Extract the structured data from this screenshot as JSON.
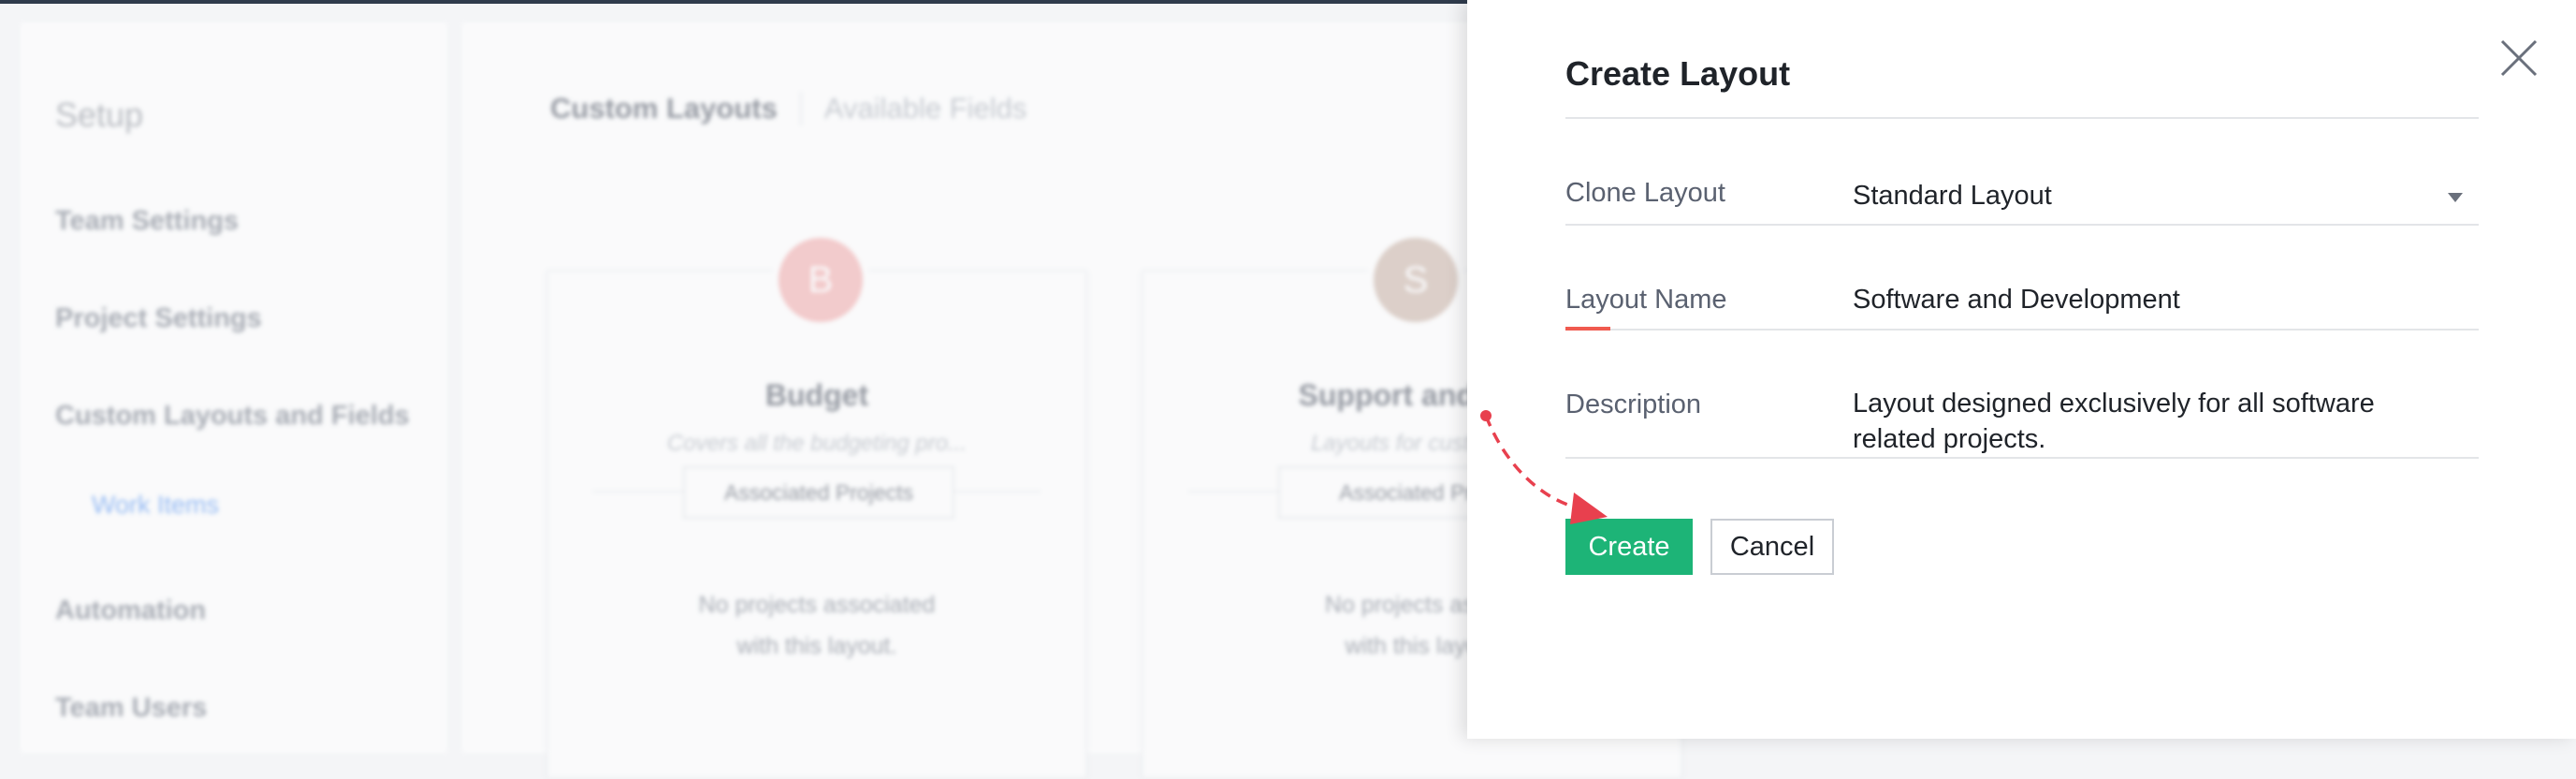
{
  "background": {
    "sidebar": {
      "title": "Setup",
      "items": [
        {
          "label": "Team Settings"
        },
        {
          "label": "Project Settings"
        },
        {
          "label": "Custom Layouts and Fields"
        },
        {
          "label": "Work Items",
          "sub": true
        },
        {
          "label": "Automation"
        },
        {
          "label": "Team Users"
        }
      ]
    },
    "tabs": [
      {
        "label": "Custom Layouts",
        "active": true
      },
      {
        "label": "Available Fields",
        "active": false
      }
    ],
    "cards": [
      {
        "avatar": "B",
        "avatar_color": "#f2a9a9",
        "title": "Budget",
        "description": "Covers all the budgeting pro...",
        "button": "Associated Projects",
        "note_line1": "No projects associated",
        "note_line2": "with this layout."
      },
      {
        "avatar": "S",
        "avatar_color": "#c9b1a4",
        "title": "Support and Tic",
        "description": "Layouts for custome",
        "button": "Associated Proj",
        "note_line1": "No projects asso",
        "note_line2": "with this layo"
      }
    ]
  },
  "panel": {
    "title": "Create Layout",
    "close_icon": "close-icon",
    "fields": {
      "clone": {
        "label": "Clone Layout",
        "value": "Standard Layout"
      },
      "name": {
        "label": "Layout Name",
        "value": "Software and Development"
      },
      "description": {
        "label": "Description",
        "value": "Layout designed exclusively for all software related projects."
      }
    },
    "buttons": {
      "create": "Create",
      "cancel": "Cancel"
    },
    "colors": {
      "primary": "#1db477",
      "accent": "#f05a4f",
      "annotation": "#e8404e"
    }
  }
}
